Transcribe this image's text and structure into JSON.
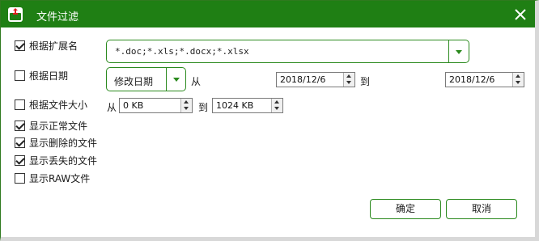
{
  "window": {
    "title": "文件过滤",
    "accent_color": "#1f7f14",
    "icon": "app-logo-icon",
    "close_icon": "close-icon"
  },
  "filters": {
    "by_extension": {
      "label": "根据扩展名",
      "checked": true,
      "value": "*.doc;*.xls;*.docx;*.xlsx"
    },
    "by_date": {
      "label": "根据日期",
      "checked": false,
      "date_type": "修改日期",
      "from_label": "从",
      "from_value": "2018/12/6",
      "to_label": "到",
      "to_value": "2018/12/6"
    },
    "by_size": {
      "label": "根据文件大小",
      "checked": false,
      "from_label": "从",
      "from_value": "0 KB",
      "to_label": "到",
      "to_value": "1024 KB"
    }
  },
  "options": [
    {
      "label": "显示正常文件",
      "checked": true
    },
    {
      "label": "显示删除的文件",
      "checked": true
    },
    {
      "label": "显示丢失的文件",
      "checked": true
    },
    {
      "label": "显示RAW文件",
      "checked": false
    }
  ],
  "buttons": {
    "ok": "确定",
    "cancel": "取消"
  }
}
